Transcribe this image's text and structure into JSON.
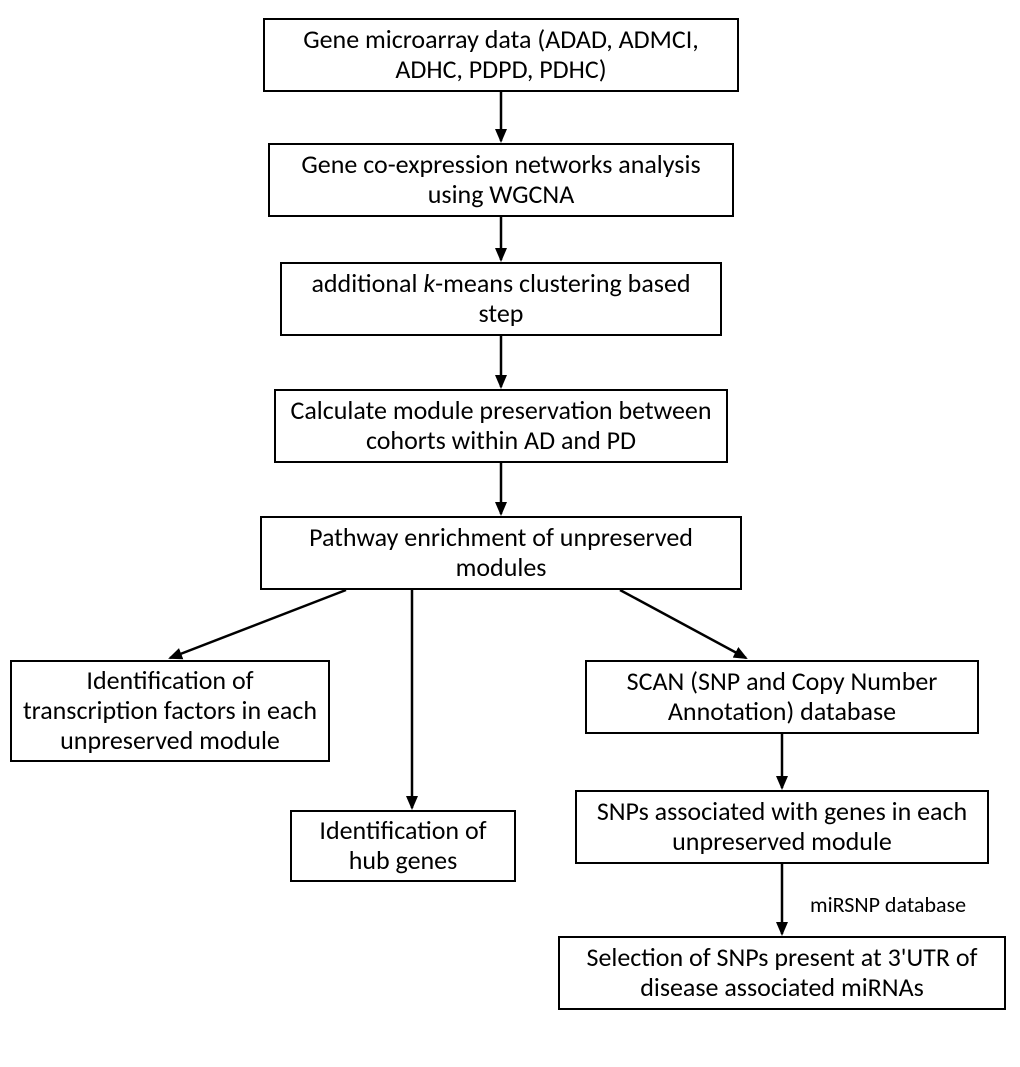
{
  "nodes": {
    "n1": "Gene microarray data (ADAD, ADMCI, ADHC, PDPD, PDHC)",
    "n2": "Gene co-expression networks analysis using WGCNA",
    "n3_pre": "additional ",
    "n3_k": "k",
    "n3_post": "-means clustering based step",
    "n4": "Calculate module preservation between cohorts within AD and PD",
    "n5": "Pathway enrichment of unpreserved modules",
    "n6": "Identification of transcription factors in each unpreserved module",
    "n7": "Identification of hub genes",
    "n8": "SCAN (SNP and Copy Number Annotation) database",
    "n9": "SNPs associated with genes in each unpreserved module",
    "n10": "Selection of SNPs present at 3'UTR of disease associated miRNAs"
  },
  "labels": {
    "mirsnp": "miRSNP database"
  }
}
